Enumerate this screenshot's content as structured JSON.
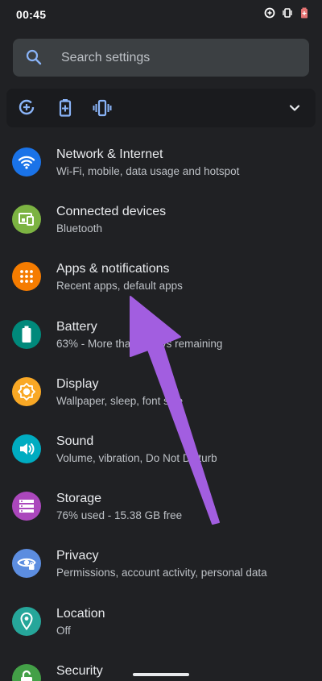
{
  "status_bar": {
    "time": "00:45",
    "icons": [
      "data-saver-icon",
      "vibrate-icon",
      "battery-saver-icon"
    ]
  },
  "search": {
    "placeholder": "Search settings"
  },
  "quick_settings": {
    "icons": [
      "data-saver-icon",
      "battery-saver-icon",
      "vibrate-icon"
    ],
    "expand_icon": "chevron-down-icon"
  },
  "settings": [
    {
      "title": "Network & Internet",
      "subtitle": "Wi-Fi, mobile, data usage and hotspot",
      "icon": "wifi-icon",
      "color": "#1a73e8"
    },
    {
      "title": "Connected devices",
      "subtitle": "Bluetooth",
      "icon": "devices-icon",
      "color": "#7cb342"
    },
    {
      "title": "Apps & notifications",
      "subtitle": "Recent apps, default apps",
      "icon": "apps-icon",
      "color": "#f57c00"
    },
    {
      "title": "Battery",
      "subtitle": "63% - More than 2 days remaining",
      "icon": "battery-icon",
      "color": "#00897b"
    },
    {
      "title": "Display",
      "subtitle": "Wallpaper, sleep, font size",
      "icon": "brightness-icon",
      "color": "#f9a825"
    },
    {
      "title": "Sound",
      "subtitle": "Volume, vibration, Do Not Disturb",
      "icon": "volume-icon",
      "color": "#00acc1"
    },
    {
      "title": "Storage",
      "subtitle": "76% used - 15.38 GB free",
      "icon": "storage-icon",
      "color": "#ab47bc"
    },
    {
      "title": "Privacy",
      "subtitle": "Permissions, account activity, personal data",
      "icon": "eye-icon",
      "color": "#5c8de0"
    },
    {
      "title": "Location",
      "subtitle": "Off",
      "icon": "location-pin-icon",
      "color": "#26a69a"
    },
    {
      "title": "Security",
      "subtitle": "",
      "icon": "lock-icon",
      "color": "#43a047"
    }
  ],
  "annotation": {
    "arrow_color": "#a25ee0"
  }
}
